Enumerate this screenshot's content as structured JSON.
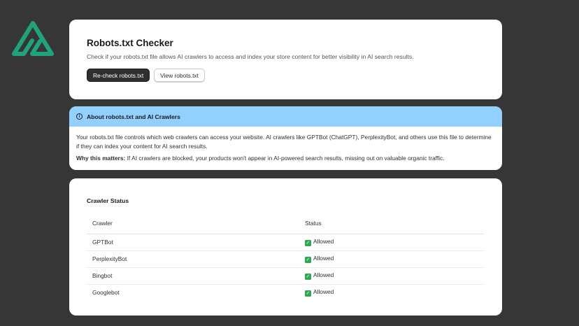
{
  "header": {
    "title": "Robots.txt Checker",
    "description": "Check if your robots.txt file allows AI crawlers to access and index your store content for better visibility in AI search results.",
    "recheck_label": "Re-check robots.txt",
    "view_label": "View robots.txt"
  },
  "banner": {
    "title": "About robots.txt and AI Crawlers",
    "body": "Your robots.txt file controls which web crawlers can access your website. AI crawlers like GPTBot (ChatGPT), PerplexityBot, and others use this file to determine if they can index your content for AI search results.",
    "why_label": "Why this matters:",
    "why_text": " If AI crawlers are blocked, your products won't appear in AI-powered search results, missing out on valuable organic traffic."
  },
  "status": {
    "title": "Crawler Status",
    "columns": [
      "Crawler",
      "Status"
    ],
    "rows": [
      {
        "crawler": "GPTBot",
        "status": "Allowed"
      },
      {
        "crawler": "PerplexityBot",
        "status": "Allowed"
      },
      {
        "crawler": "Bingbot",
        "status": "Allowed"
      },
      {
        "crawler": "Googlebot",
        "status": "Allowed"
      }
    ]
  },
  "icons": {
    "logo": "brand-logo-icon",
    "info": "info-icon",
    "check": "check-icon"
  },
  "colors": {
    "background": "#363636",
    "banner": "#91d0ff",
    "logo": "#1fa37a",
    "check": "#2fa84f",
    "primary_button": "#303030"
  }
}
